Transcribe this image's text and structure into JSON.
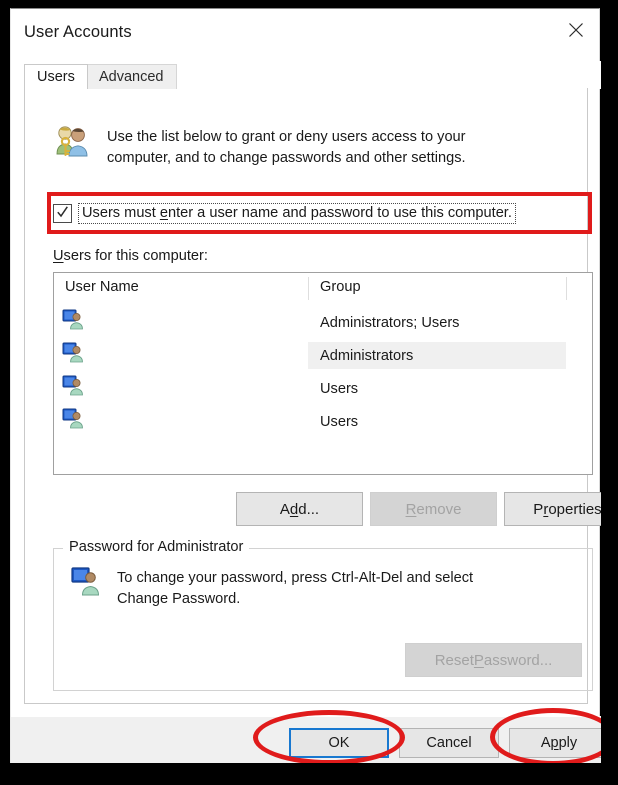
{
  "window": {
    "title": "User Accounts",
    "close_icon": "close-icon"
  },
  "tabs": [
    {
      "label": "Users",
      "active": true
    },
    {
      "label": "Advanced",
      "active": false
    }
  ],
  "intro": {
    "icon": "users-key-icon",
    "line1": "Use the list below to grant or deny users access to your",
    "line2": "computer, and to change passwords and other settings."
  },
  "checkbox": {
    "checked": true,
    "label_before": "Users must ",
    "label_accel": "e",
    "label_after": "nter a user name and password to use this computer.",
    "highlight_color": "#e01b1b"
  },
  "list": {
    "caption_accel": "U",
    "caption_after": "sers for this computer:",
    "columns": [
      "User Name",
      "Group"
    ],
    "rows": [
      {
        "icon": "user-computer-icon",
        "user": "",
        "group": "Administrators; Users",
        "selected": false
      },
      {
        "icon": "user-computer-icon",
        "user": "",
        "group": "Administrators",
        "selected": true
      },
      {
        "icon": "user-computer-icon",
        "user": "",
        "group": "Users",
        "selected": false
      },
      {
        "icon": "user-computer-icon",
        "user": "",
        "group": "Users",
        "selected": false
      }
    ]
  },
  "buttons": {
    "add": {
      "before": "A",
      "accel": "d",
      "after": "d...",
      "disabled": false
    },
    "remove": {
      "before": "",
      "accel": "R",
      "after": "emove",
      "disabled": true
    },
    "properties": {
      "before": "P",
      "accel": "r",
      "after": "operties",
      "disabled": false
    }
  },
  "password_group": {
    "legend": "Password for Administrator",
    "icon": "user-computer-icon",
    "line1": "To change your password, press Ctrl-Alt-Del and select",
    "line2": "Change Password.",
    "reset_button": {
      "before": "Reset ",
      "accel": "P",
      "after": "assword...",
      "disabled": true
    }
  },
  "footer": {
    "ok": {
      "label": "OK",
      "focused": true,
      "annotated": true
    },
    "cancel": {
      "label": "Cancel",
      "focused": false,
      "annotated": false
    },
    "apply": {
      "before": "A",
      "accel": "p",
      "after": "ply",
      "focused": false,
      "annotated": true
    }
  },
  "annotations": {
    "color": "#e01b1b",
    "shapes": [
      "rectangle-around-checkbox",
      "ellipse-around-ok",
      "ellipse-around-apply"
    ]
  }
}
